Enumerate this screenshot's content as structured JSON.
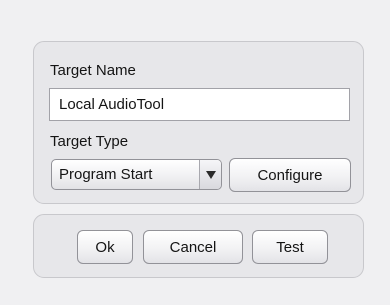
{
  "target": {
    "name_label": "Target Name",
    "name_value": "Local AudioTool",
    "type_label": "Target Type",
    "type_selected": "Program Start",
    "configure_label": "Configure"
  },
  "actions": {
    "ok_label": "Ok",
    "cancel_label": "Cancel",
    "test_label": "Test"
  },
  "icons": {
    "dropdown": "triangle-down-icon"
  }
}
